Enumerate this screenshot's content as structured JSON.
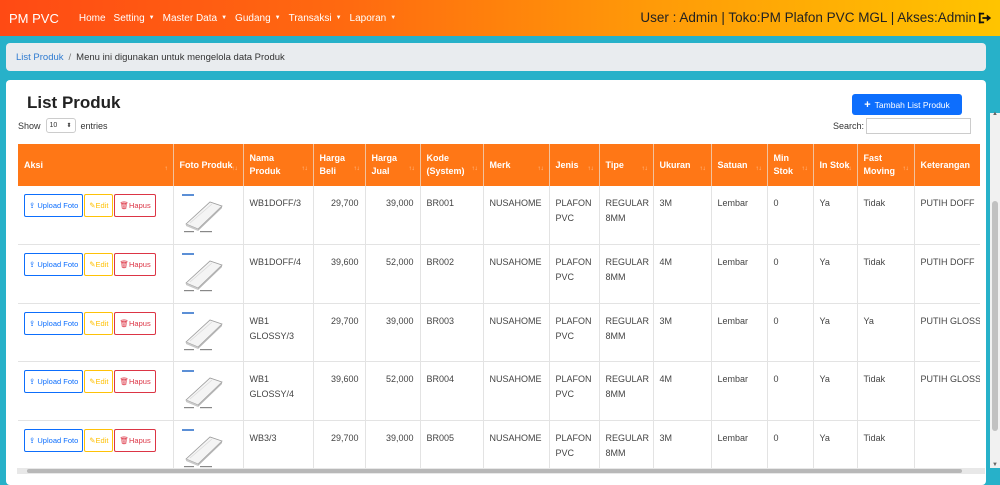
{
  "navbar": {
    "brand": "PM PVC",
    "items": [
      {
        "label": "Home",
        "has_caret": false
      },
      {
        "label": "Setting",
        "has_caret": true
      },
      {
        "label": "Master Data",
        "has_caret": true
      },
      {
        "label": "Gudang",
        "has_caret": true
      },
      {
        "label": "Transaksi",
        "has_caret": true
      },
      {
        "label": "Laporan",
        "has_caret": true
      }
    ],
    "user_info": "User : Admin | Toko:PM Plafon PVC MGL | Akses:Admin",
    "logout_icon": "logout-icon"
  },
  "breadcrumb": {
    "link": "List Produk",
    "separator": "/",
    "description": "Menu ini digunakan untuk mengelola data Produk"
  },
  "page": {
    "title": "List Produk",
    "add_button": "Tambah List Produk",
    "show_label": "Show",
    "entries_value": "10",
    "entries_label": "entries",
    "search_label": "Search:"
  },
  "table": {
    "columns": [
      "Aksi",
      "Foto Produk",
      "Nama Produk",
      "Harga Beli",
      "Harga Jual",
      "Kode (System)",
      "Merk",
      "Jenis",
      "Tipe",
      "Ukuran",
      "Satuan",
      "Min Stok",
      "In Stok",
      "Fast Moving",
      "Keterangan"
    ],
    "action_labels": {
      "upload": "Upload Foto",
      "edit": "Edit",
      "hapus": "Hapus"
    },
    "rows": [
      {
        "nama": "WB1DOFF/3",
        "harga_beli": "29,700",
        "harga_jual": "39,000",
        "kode": "BR001",
        "merk": "NUSAHOME",
        "jenis": "PLAFON PVC",
        "tipe": "REGULAR 8MM",
        "ukuran": "3M",
        "satuan": "Lembar",
        "min_stok": "0",
        "in_stok": "Ya",
        "fast_moving": "Tidak",
        "keterangan": "PUTIH DOFF"
      },
      {
        "nama": "WB1DOFF/4",
        "harga_beli": "39,600",
        "harga_jual": "52,000",
        "kode": "BR002",
        "merk": "NUSAHOME",
        "jenis": "PLAFON PVC",
        "tipe": "REGULAR 8MM",
        "ukuran": "4M",
        "satuan": "Lembar",
        "min_stok": "0",
        "in_stok": "Ya",
        "fast_moving": "Tidak",
        "keterangan": "PUTIH DOFF"
      },
      {
        "nama": "WB1 GLOSSY/3",
        "harga_beli": "29,700",
        "harga_jual": "39,000",
        "kode": "BR003",
        "merk": "NUSAHOME",
        "jenis": "PLAFON PVC",
        "tipe": "REGULAR 8MM",
        "ukuran": "3M",
        "satuan": "Lembar",
        "min_stok": "0",
        "in_stok": "Ya",
        "fast_moving": "Ya",
        "keterangan": "PUTIH GLOSSY"
      },
      {
        "nama": "WB1 GLOSSY/4",
        "harga_beli": "39,600",
        "harga_jual": "52,000",
        "kode": "BR004",
        "merk": "NUSAHOME",
        "jenis": "PLAFON PVC",
        "tipe": "REGULAR 8MM",
        "ukuran": "4M",
        "satuan": "Lembar",
        "min_stok": "0",
        "in_stok": "Ya",
        "fast_moving": "Tidak",
        "keterangan": "PUTIH GLOSSY"
      },
      {
        "nama": "WB3/3",
        "harga_beli": "29,700",
        "harga_jual": "39,000",
        "kode": "BR005",
        "merk": "NUSAHOME",
        "jenis": "PLAFON PVC",
        "tipe": "REGULAR 8MM",
        "ukuran": "3M",
        "satuan": "Lembar",
        "min_stok": "0",
        "in_stok": "Ya",
        "fast_moving": "Tidak",
        "keterangan": ""
      }
    ]
  }
}
